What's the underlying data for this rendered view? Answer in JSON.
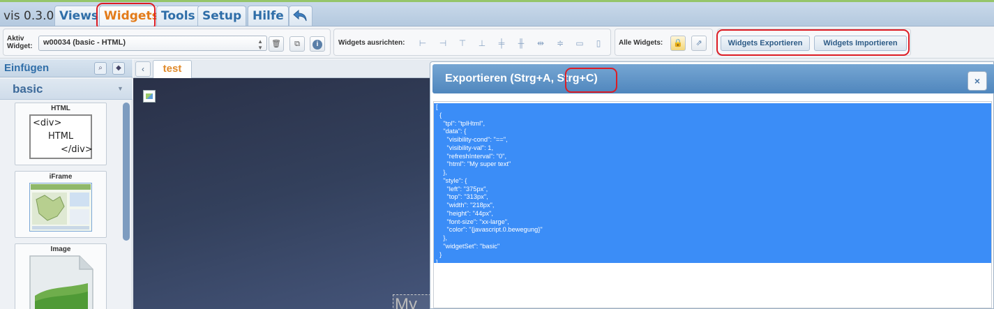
{
  "app": {
    "version": "vis 0.3.0"
  },
  "menu": {
    "tabs": [
      {
        "label": "Views"
      },
      {
        "label": "Widgets"
      },
      {
        "label": "Tools"
      },
      {
        "label": "Setup"
      },
      {
        "label": "Hilfe"
      }
    ],
    "undo_icon": "undo-arrow-icon"
  },
  "toolbar": {
    "active_widget_label": "Aktiv\nWidget:",
    "active_widget_value": "w00034 (basic - HTML)",
    "active_widget_buttons": [
      "trash-icon",
      "copy-icon",
      "info-icon"
    ],
    "align_label": "Widgets ausrichten:",
    "align_icons": [
      "align-left-icon",
      "align-right-icon",
      "align-top-icon",
      "align-bottom-icon",
      "align-vcenter-icon",
      "align-hcenter-icon",
      "distribute-h-icon",
      "distribute-v-icon",
      "same-width-icon",
      "same-height-icon"
    ],
    "all_widgets_label": "Alle Widgets:",
    "lock_icon": "lock-icon",
    "external_icon": "external-link-icon",
    "export_label": "Widgets Exportieren",
    "import_label": "Widgets Importieren"
  },
  "sidebar": {
    "title": "Einfügen",
    "category": "basic",
    "icons": [
      "search-icon",
      "tag-icon"
    ],
    "widgets": [
      {
        "title": "HTML",
        "preview_lines": [
          "<div>",
          "HTML",
          "</div>"
        ]
      },
      {
        "title": "iFrame"
      },
      {
        "title": "Image"
      }
    ]
  },
  "canvas": {
    "view_tab": "test",
    "ghost_text": "My"
  },
  "dialog": {
    "title": "Exportieren (Strg+A, Strg+C)",
    "close_label": "×",
    "content": "[\n  {\n    \"tpl\": \"tplHtml\",\n    \"data\": {\n      \"visibility-cond\": \"==\",\n      \"visibility-val\": 1,\n      \"refreshInterval\": \"0\",\n      \"html\": \"My super text\"\n    },\n    \"style\": {\n      \"left\": \"375px\",\n      \"top\": \"313px\",\n      \"width\": \"218px\",\n      \"height\": \"44px\",\n      \"font-size\": \"xx-large\",\n      \"color\": \"{javascript.0.bewegung}\"\n    },\n    \"widgetSet\": \"basic\"\n  }\n]"
  },
  "colors": {
    "accent": "#2f6ea8",
    "active_tab": "#e37b19",
    "highlight": "#dd1c24",
    "selection": "#3b8df7",
    "dialog_header": "#5a8fc4"
  }
}
